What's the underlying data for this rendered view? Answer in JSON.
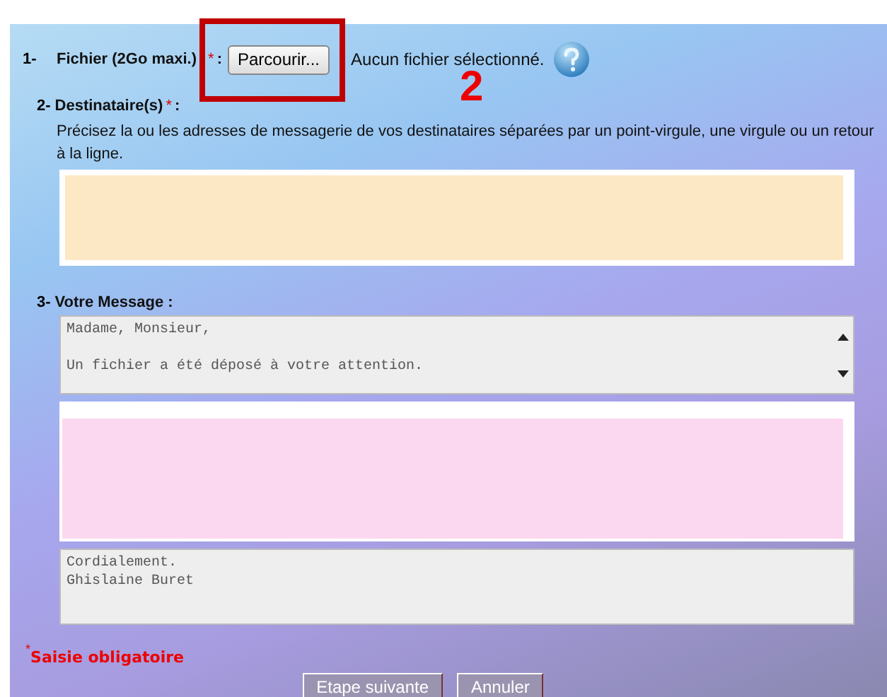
{
  "file_field": {
    "number": "1-",
    "label": "Fichier (2Go maxi.)",
    "required_mark": "*",
    "colon": ":",
    "browse_button": "Parcourir...",
    "status": "Aucun fichier sélectionné."
  },
  "recipients": {
    "number": "2-",
    "label": "Destinataire(s)",
    "required_mark": "*",
    "colon": ":",
    "hint": "Précisez la ou les adresses de messagerie de vos destinataires séparées par un point-virgule, une virgule ou un retour à la ligne."
  },
  "message": {
    "number": "3-",
    "label": "Votre Message :",
    "header_text": [
      "Madame, Monsieur,",
      "Un fichier a été déposé à votre attention."
    ],
    "footer_text": [
      "Cordialement.",
      "Ghislaine Buret"
    ]
  },
  "required_note": {
    "mark": "*",
    "text": "Saisie obligatoire"
  },
  "buttons": [
    "Etape suivante",
    "Annuler"
  ],
  "annotation": {
    "label": "2"
  }
}
